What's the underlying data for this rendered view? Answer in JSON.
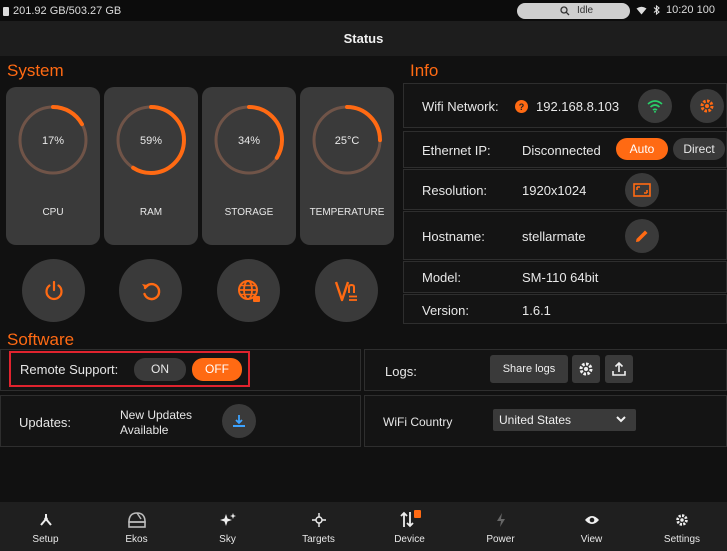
{
  "statusbar": {
    "storage": "201.92 GB/503.27 GB",
    "search_label": "Idle",
    "time": "10:20 100"
  },
  "header": {
    "title": "Status"
  },
  "system": {
    "title": "System",
    "cards": [
      {
        "label": "CPU",
        "value_text": "17%",
        "value": 17
      },
      {
        "label": "RAM",
        "value_text": "59%",
        "value": 59
      },
      {
        "label": "STORAGE",
        "value_text": "34%",
        "value": 34
      },
      {
        "label": "TEMPERATURE",
        "value_text": "25°C",
        "value": 25
      }
    ],
    "buttons": [
      {
        "icon": "power-icon"
      },
      {
        "icon": "restart-icon"
      },
      {
        "icon": "globe-icon"
      },
      {
        "icon": "vnc-icon"
      }
    ]
  },
  "info": {
    "title": "Info",
    "wifi": {
      "label": "Wifi Network:",
      "value": "192.168.8.103"
    },
    "ethernet": {
      "label": "Ethernet IP:",
      "value": "Disconnected",
      "auto": "Auto",
      "direct": "Direct"
    },
    "resolution": {
      "label": "Resolution:",
      "value": "1920x1024"
    },
    "hostname": {
      "label": "Hostname:",
      "value": "stellarmate"
    },
    "model": {
      "label": "Model:",
      "value": "SM-110 64bit"
    },
    "version": {
      "label": "Version:",
      "value": "1.6.1"
    }
  },
  "software": {
    "title": "Software",
    "remote_support": {
      "label": "Remote Support:",
      "on": "ON",
      "off": "OFF"
    },
    "logs": {
      "label": "Logs:",
      "share": "Share logs"
    },
    "updates": {
      "label": "Updates:",
      "status_line1": "New Updates",
      "status_line2": "Available"
    },
    "wifi_country": {
      "label": "WiFi Country",
      "value": "United States"
    }
  },
  "colors": {
    "accent": "#ff6a13",
    "card": "#3a3a3a",
    "highlight": "#e0232e",
    "wifi_green": "#29d16a"
  },
  "nav": {
    "items": [
      {
        "label": "Setup"
      },
      {
        "label": "Ekos"
      },
      {
        "label": "Sky"
      },
      {
        "label": "Targets"
      },
      {
        "label": "Device"
      },
      {
        "label": "Power"
      },
      {
        "label": "View"
      },
      {
        "label": "Settings"
      }
    ]
  }
}
